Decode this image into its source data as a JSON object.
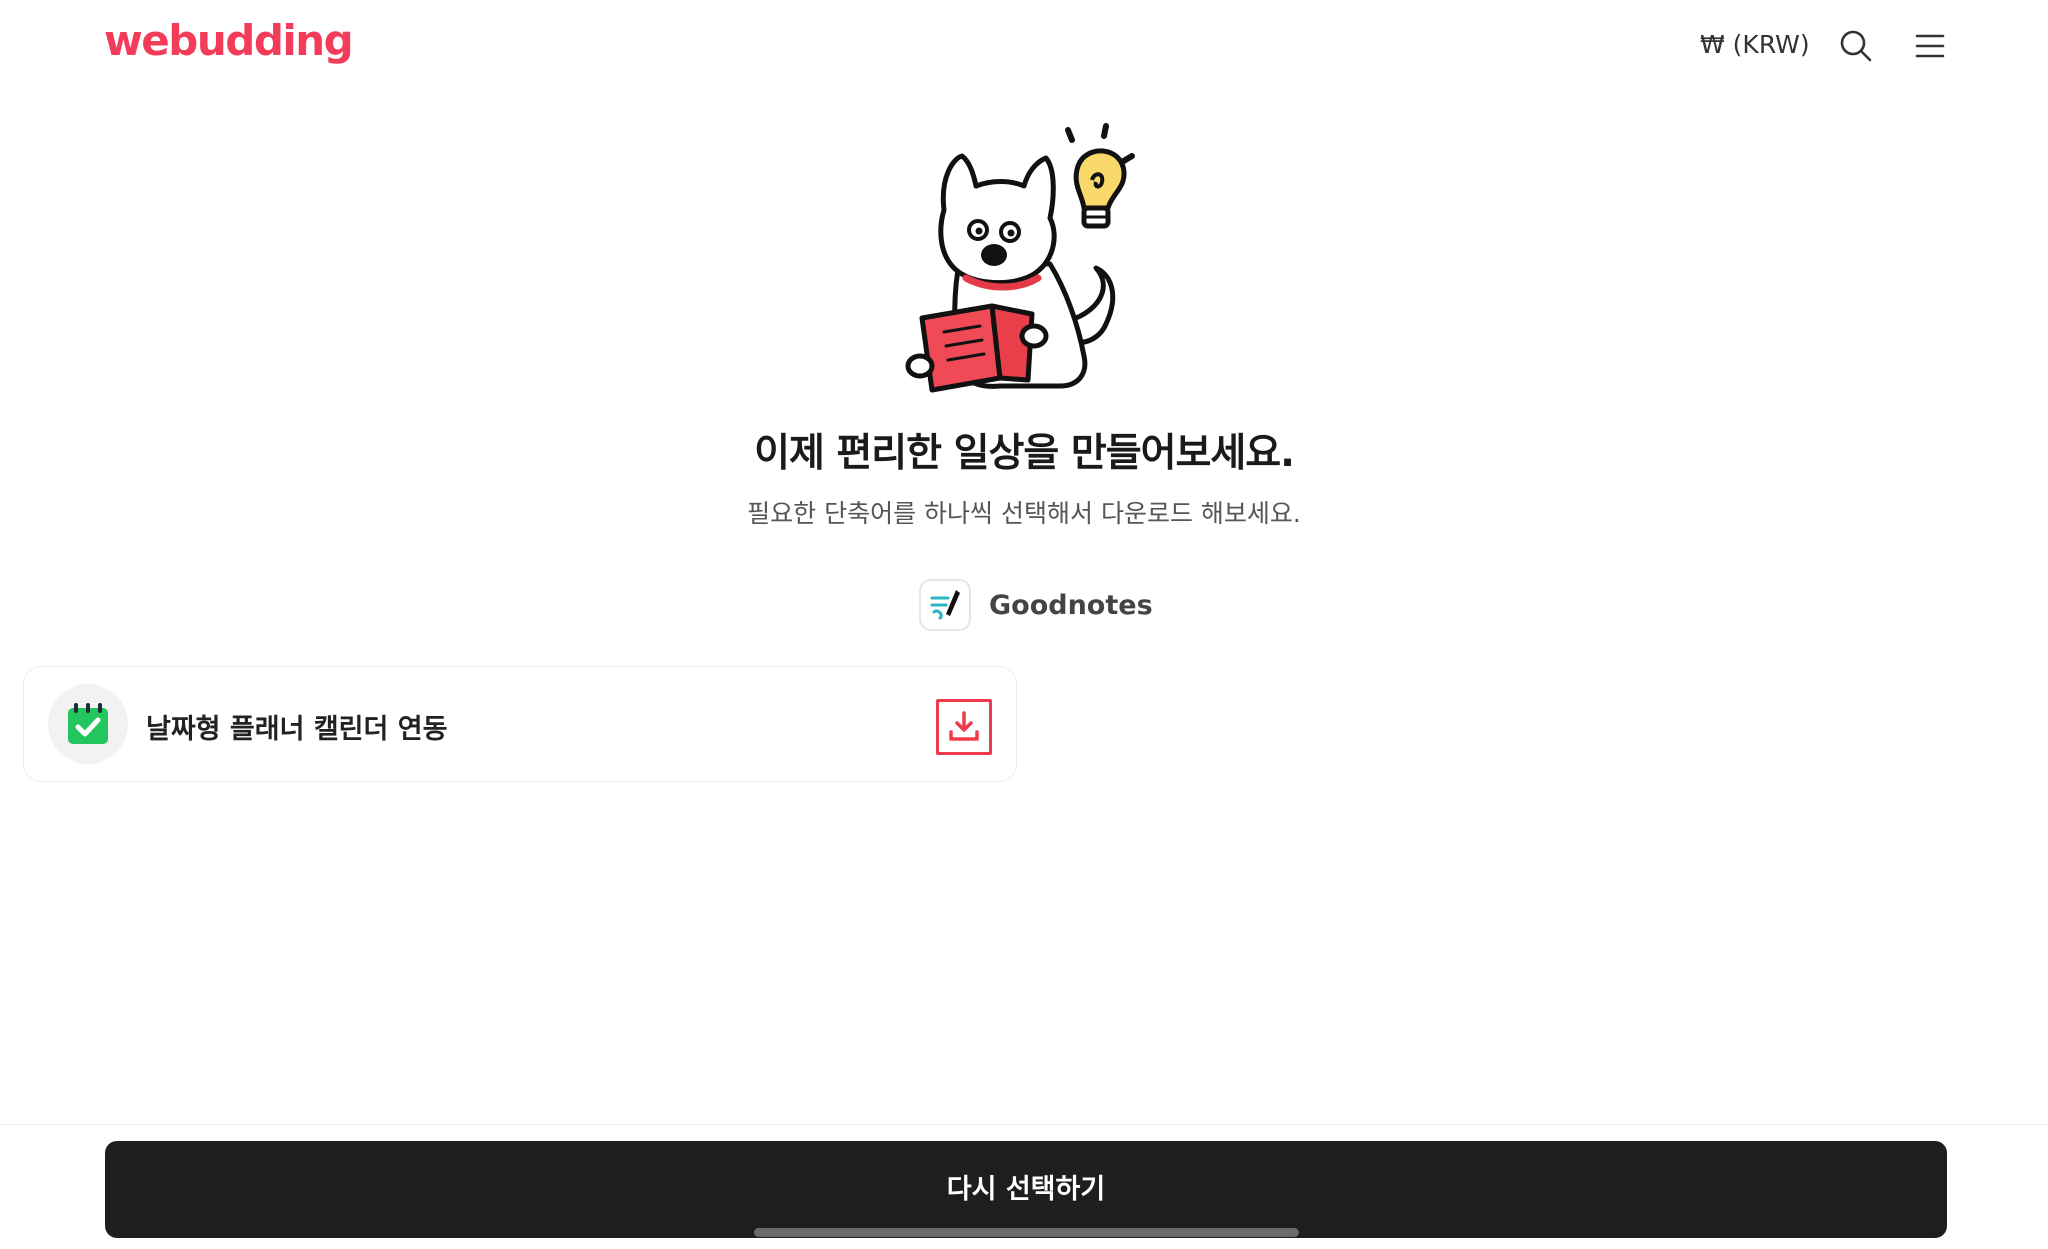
{
  "header": {
    "logo_text": "webudding",
    "currency_label": "₩ (KRW)",
    "search_icon": "search-icon",
    "menu_icon": "hamburger-menu-icon"
  },
  "hero": {
    "illustration": "dog-reading-book-with-lightbulb",
    "headline": "이제 편리한 일상을 만들어보세요.",
    "subline": "필요한 단축어를 하나씩 선택해서 다운로드 해보세요."
  },
  "app": {
    "icon": "goodnotes-app-icon",
    "name": "Goodnotes"
  },
  "shortcuts": [
    {
      "icon": "calendar-check-icon",
      "label": "날짜형 플래너 캘린더 연동",
      "action_icon": "download-icon"
    }
  ],
  "footer": {
    "reselect_label": "다시 선택하기"
  },
  "colors": {
    "brand": "#f23c5a",
    "download_accent": "#ef3b4b",
    "calendar_green": "#22c55e",
    "button_dark": "#1e1e1e"
  }
}
